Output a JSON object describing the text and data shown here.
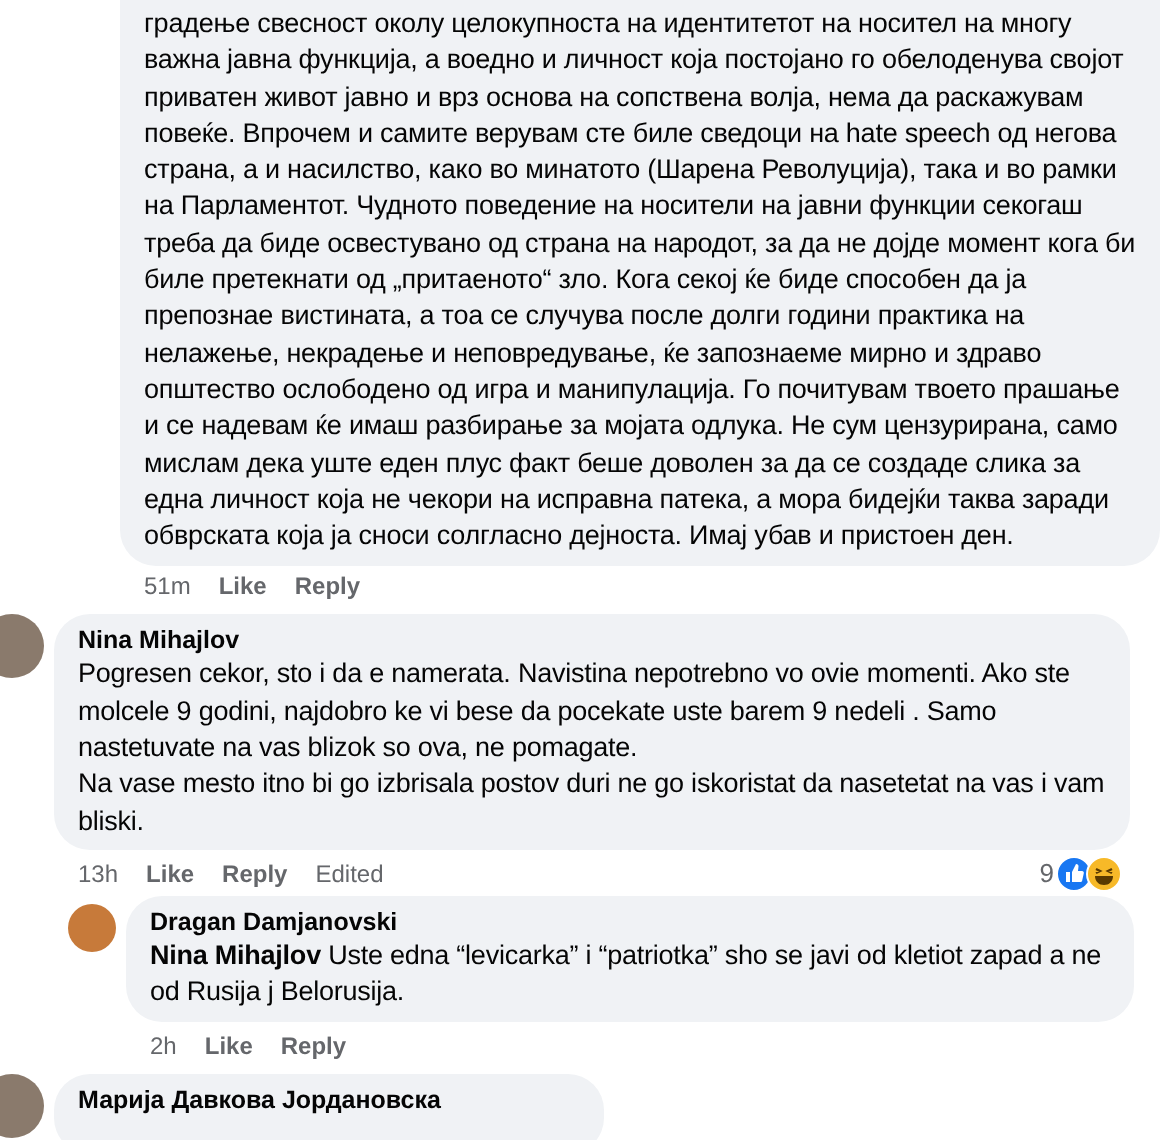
{
  "partial_reply": {
    "paragraphs": [
      "градење свесност околу целокупноста на идентитетот на носител на многу важна јавна функција, а воедно и личност која постојано го обелоденува својот приватен живот јавно и врз основа на сопствена волја, нема да раскажувам повеќе. Впрочем и самите верувам сте биле сведоци на hate speech од негова страна, а и насилство, како во минатото (Шарена Револуција), така и во рамки на Парламентот. Чудното поведение на носители на јавни функции секогаш треба да биде освестувано од страна на народот, за да не дојде момент кога би биле претекнати од „притаеното“ зло. Кога секој ќе биде способен да ја препознае вистината, а тоа се случува после долги години практика на нелажење, некрадење и неповредување, ќе запознаеме мирно и здраво општество ослободено од игра и манипулација. Го почитувам твоето прашање и се надевам ќе имаш разбирање за мојата одлука. Не сум цензурирана, само мислам дека уште еден плус факт беше доволен за да се создаде слика за една личност која не чекори на исправна патека, а мора бидејќи таква заради обврската која ја сноси солгласно дејноста. Имај убав и пристоен ден."
    ],
    "time": "51m",
    "actions": [
      "Like",
      "Reply"
    ]
  },
  "comments": [
    {
      "author": "Nina Mihajlov",
      "paragraphs": [
        "Pogresen cekor, sto i da e namerata. Navistina nepotrebno vo ovie momenti. Ako ste molcele 9 godini, najdobro ke vi bese da pocekate uste barem 9 nedeli . Samo nastetuvate na vas blizok so ova, ne pomagate.",
        "Na vase mesto itno bi go izbrisala postov duri ne go iskoristat da nasetetat na vas i vam bliski."
      ],
      "time": "13h",
      "actions": [
        "Like",
        "Reply"
      ],
      "edited": "Edited",
      "reactions": {
        "count": "9"
      },
      "replies": [
        {
          "author": "Dragan Damjanovski",
          "paragraphs": [
            "**Nina Mihajlov** Uste edna “levicarka” i “patriotka” sho se javi od kletiot zapad a ne od Rusija j Belorusija."
          ],
          "time": "2h",
          "actions": [
            "Like",
            "Reply"
          ]
        }
      ]
    },
    {
      "author": "Марија Давкова Јордановска"
    }
  ]
}
